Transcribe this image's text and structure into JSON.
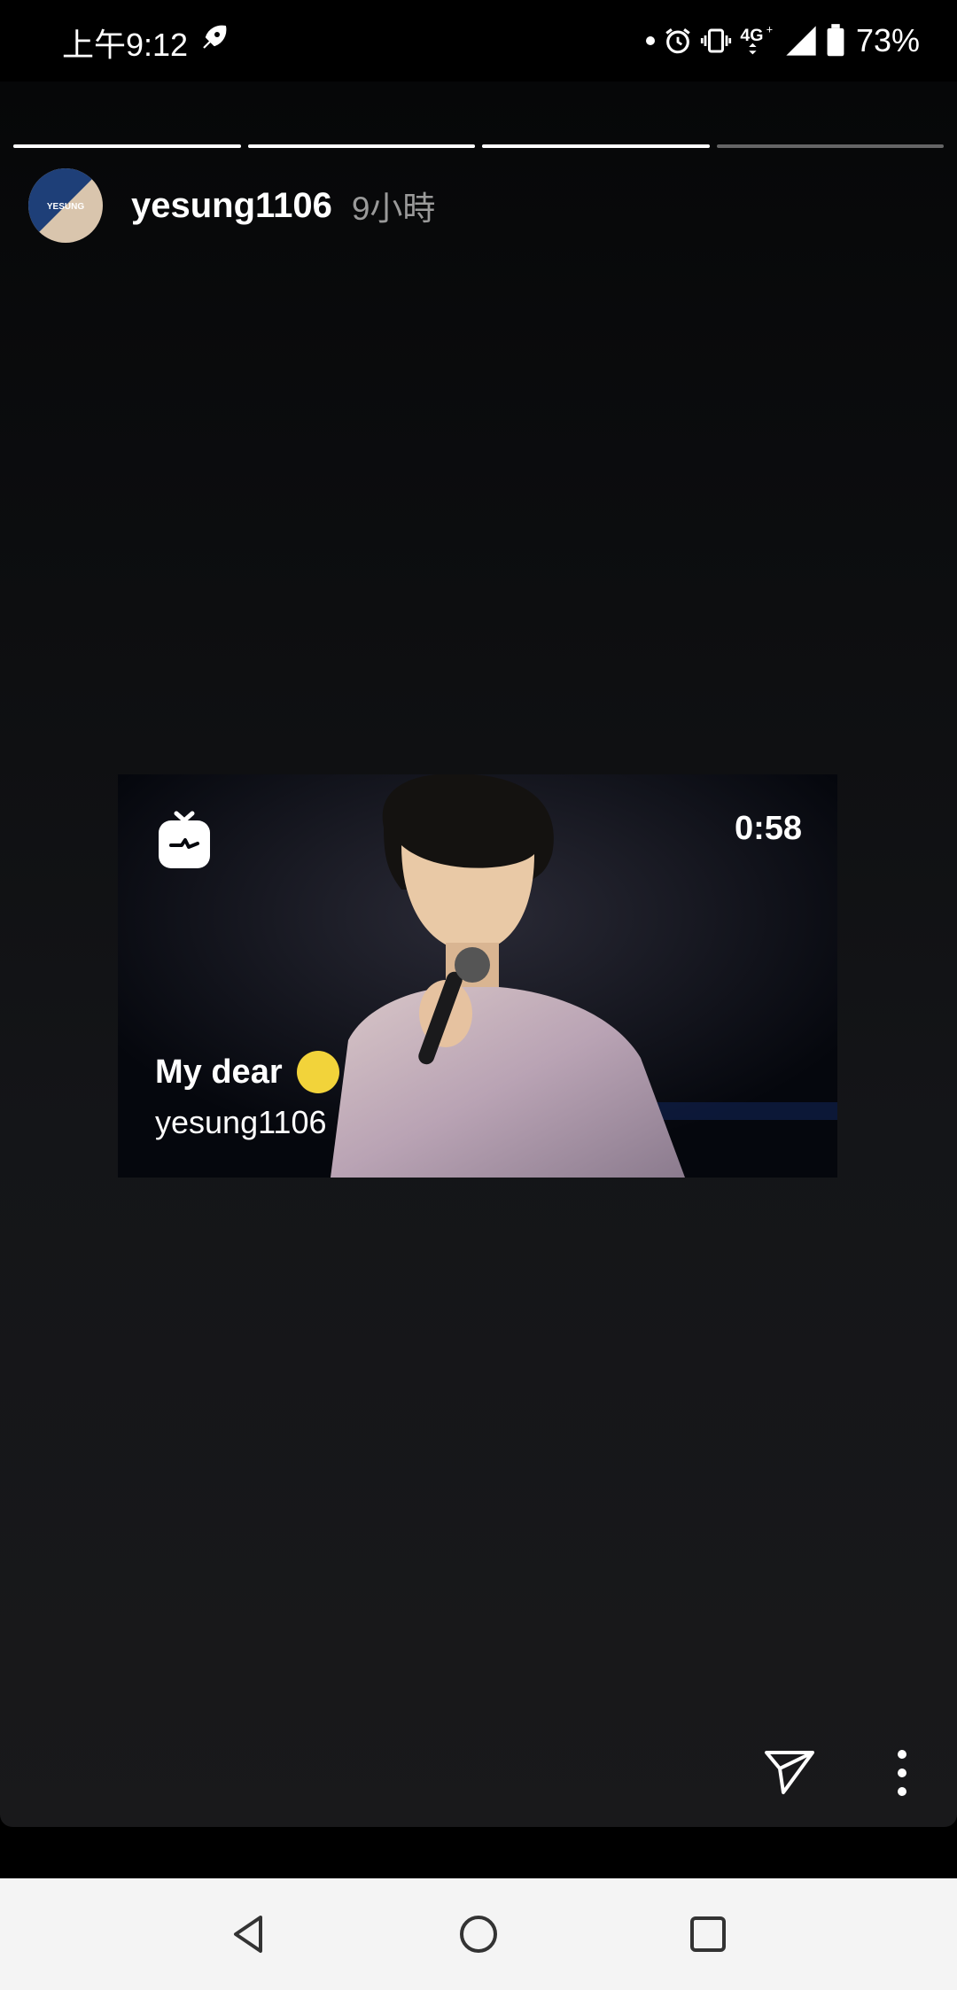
{
  "status_bar": {
    "time": "上午9:12",
    "network": "4G",
    "battery": "73%"
  },
  "story": {
    "progress_segments": [
      1,
      1,
      1,
      0.0
    ],
    "username": "yesung1106",
    "time_ago": "9小時",
    "avatar_text": "YESUNG"
  },
  "media": {
    "duration": "0:58",
    "caption_title": "My dear",
    "caption_user": "yesung1106"
  },
  "colors": {
    "avatar_blue": "#1e3f78",
    "avatar_beige": "#d9c5ad",
    "emoji_yellow": "#f2d33a"
  },
  "icons": {
    "rocket": "rocket-icon",
    "alarm": "alarm-icon",
    "vibrate": "vibrate-icon",
    "signal": "signal-icon",
    "battery": "battery-icon",
    "igtv": "igtv-icon",
    "send": "send-icon",
    "more": "more-vertical-icon",
    "back": "back-icon",
    "home": "home-icon",
    "recents": "recents-icon"
  }
}
